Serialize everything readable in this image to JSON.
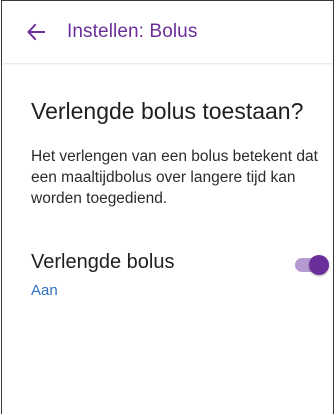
{
  "appbar": {
    "title": "Instellen: Bolus",
    "back_icon": "arrow-left-icon",
    "accent_color": "#6b2f99"
  },
  "content": {
    "heading": "Verlengde bolus toestaan?",
    "description": "Het verlengen van een bolus betekent dat een maaltijdbolus over langere tijd kan worden toegediend."
  },
  "setting": {
    "label": "Verlengde bolus",
    "value": "Aan",
    "enabled": true,
    "value_color": "#2e6fbf"
  }
}
